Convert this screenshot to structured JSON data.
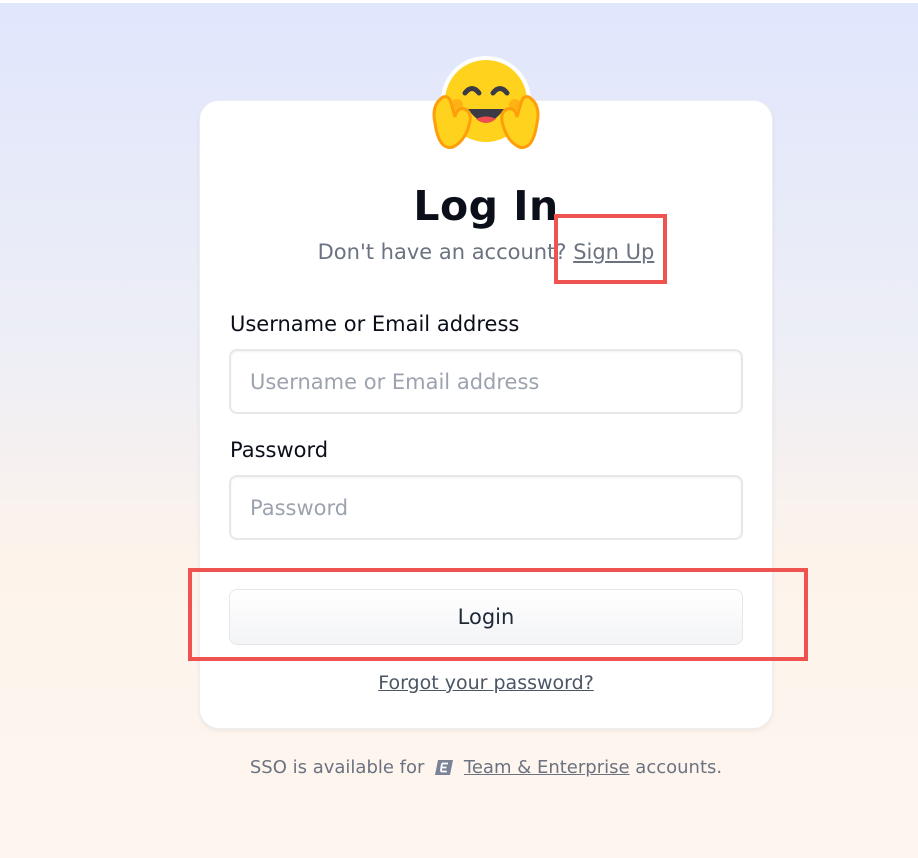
{
  "page": {
    "title": "Log In",
    "subtitle_text": "Don't have an account?",
    "signup_link": "Sign Up"
  },
  "form": {
    "username_label": "Username or Email address",
    "username_placeholder": "Username or Email address",
    "username_value": "",
    "password_label": "Password",
    "password_placeholder": "Password",
    "password_value": "",
    "login_button": "Login",
    "forgot_link": "Forgot your password?"
  },
  "footer": {
    "sso_prefix": "SSO is available for",
    "enterprise_icon": "enterprise-badge-icon",
    "enterprise_link": "Team & Enterprise",
    "sso_suffix": "accounts."
  },
  "mascot_icon": "hugging-face-emoji-icon",
  "colors": {
    "highlight": "#ef5350",
    "mascot_face": "#ffd21e",
    "mascot_shade": "#ff9d0b"
  }
}
